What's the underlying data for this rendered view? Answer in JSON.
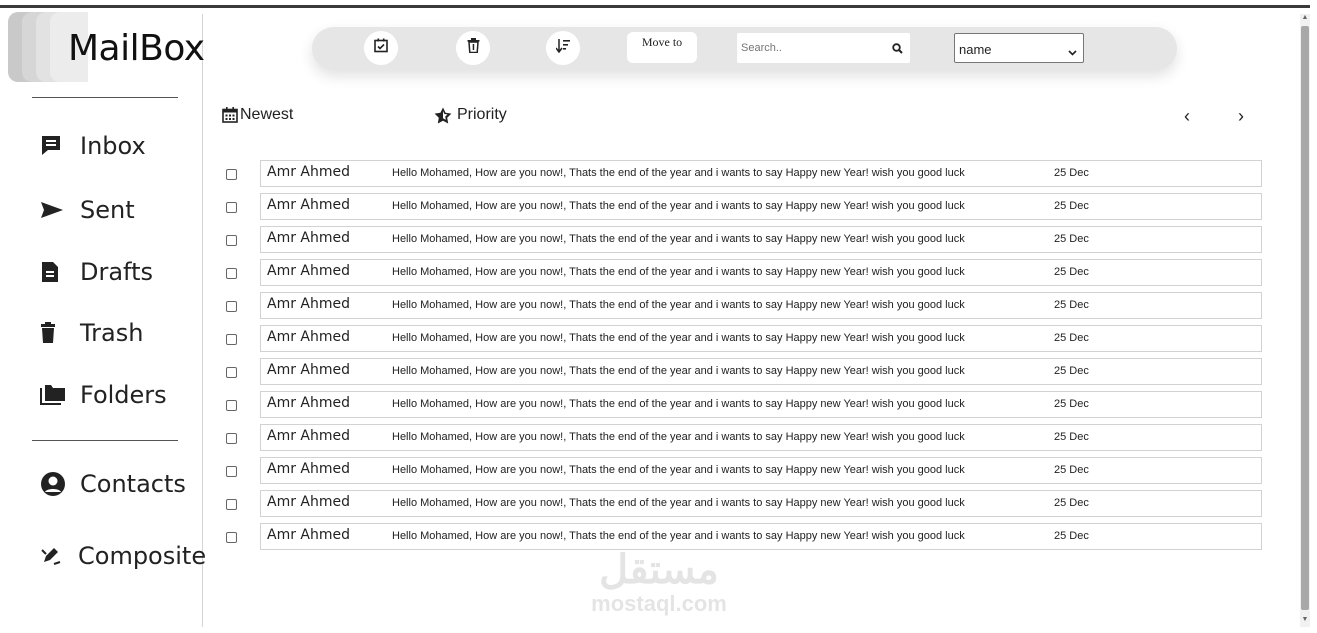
{
  "app": {
    "title": "MailBox"
  },
  "sidebar": {
    "items": [
      {
        "label": "Inbox",
        "icon": "inbox-icon"
      },
      {
        "label": "Sent",
        "icon": "paper-plane-icon"
      },
      {
        "label": "Drafts",
        "icon": "document-icon"
      },
      {
        "label": "Trash",
        "icon": "trash-icon"
      },
      {
        "label": "Folders",
        "icon": "folder-icon"
      },
      {
        "label": "Contacts",
        "icon": "user-circle-icon"
      },
      {
        "label": "Composite",
        "icon": "pen-icon"
      }
    ]
  },
  "toolbar": {
    "select_all_icon": "calendar-check-icon",
    "delete_icon": "trash-icon",
    "sort_icon": "sort-icon",
    "move_to_label": "Move to",
    "search_placeholder": "Search..",
    "search_icon": "magnifier-icon",
    "sort_select_value": "name"
  },
  "list_controls": {
    "newest_label": "Newest",
    "priority_label": "Priority",
    "prev_label": "‹",
    "next_label": "›"
  },
  "emails": [
    {
      "sender": "Amr Ahmed",
      "message": "Hello Mohamed, How are you now!, Thats the end of the year and i wants to say Happy new Year! wish you good luck",
      "date": "25 Dec"
    },
    {
      "sender": "Amr Ahmed",
      "message": "Hello Mohamed, How are you now!, Thats the end of the year and i wants to say Happy new Year! wish you good luck",
      "date": "25 Dec"
    },
    {
      "sender": "Amr Ahmed",
      "message": "Hello Mohamed, How are you now!, Thats the end of the year and i wants to say Happy new Year! wish you good luck",
      "date": "25 Dec"
    },
    {
      "sender": "Amr Ahmed",
      "message": "Hello Mohamed, How are you now!, Thats the end of the year and i wants to say Happy new Year! wish you good luck",
      "date": "25 Dec"
    },
    {
      "sender": "Amr Ahmed",
      "message": "Hello Mohamed, How are you now!, Thats the end of the year and i wants to say Happy new Year! wish you good luck",
      "date": "25 Dec"
    },
    {
      "sender": "Amr Ahmed",
      "message": "Hello Mohamed, How are you now!, Thats the end of the year and i wants to say Happy new Year! wish you good luck",
      "date": "25 Dec"
    },
    {
      "sender": "Amr Ahmed",
      "message": "Hello Mohamed, How are you now!, Thats the end of the year and i wants to say Happy new Year! wish you good luck",
      "date": "25 Dec"
    },
    {
      "sender": "Amr Ahmed",
      "message": "Hello Mohamed, How are you now!, Thats the end of the year and i wants to say Happy new Year! wish you good luck",
      "date": "25 Dec"
    },
    {
      "sender": "Amr Ahmed",
      "message": "Hello Mohamed, How are you now!, Thats the end of the year and i wants to say Happy new Year! wish you good luck",
      "date": "25 Dec"
    },
    {
      "sender": "Amr Ahmed",
      "message": "Hello Mohamed, How are you now!, Thats the end of the year and i wants to say Happy new Year! wish you good luck",
      "date": "25 Dec"
    },
    {
      "sender": "Amr Ahmed",
      "message": "Hello Mohamed, How are you now!, Thats the end of the year and i wants to say Happy new Year! wish you good luck",
      "date": "25 Dec"
    },
    {
      "sender": "Amr Ahmed",
      "message": "Hello Mohamed, How are you now!, Thats the end of the year and i wants to say Happy new Year! wish you good luck",
      "date": "25 Dec"
    }
  ],
  "watermark": {
    "arabic": "مستقل",
    "latin": "mostaql.com"
  },
  "colors": {
    "toolbar_bg": "#e6e6e6",
    "row_border": "#d2d2d2",
    "text": "#222222"
  }
}
